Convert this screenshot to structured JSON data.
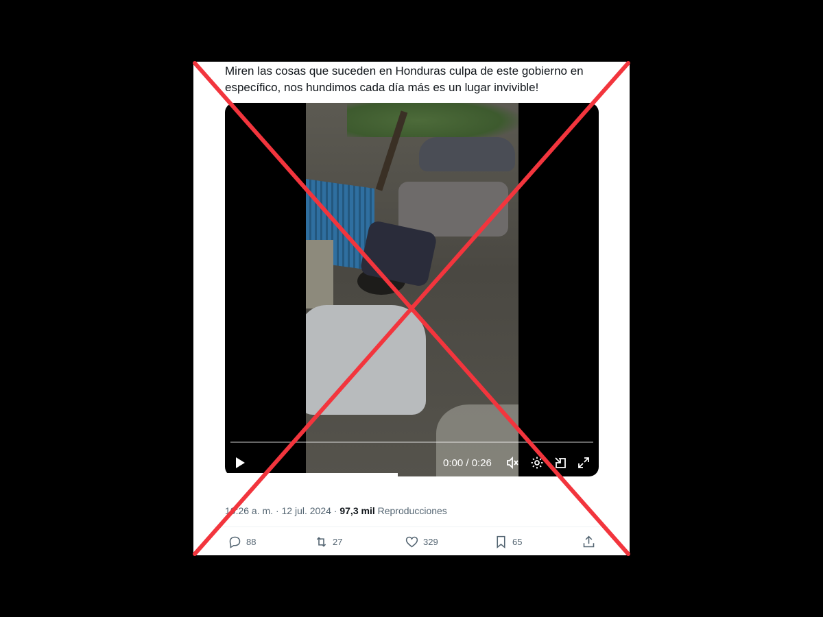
{
  "tweet": {
    "text": "Miren las cosas que suceden en Honduras culpa de este gobierno en específico, nos hundimos cada día más es un lugar invivible!"
  },
  "video": {
    "time_display": "0:00 / 0:26",
    "progress": 0
  },
  "meta": {
    "time": "10:26 a. m.",
    "separator": "·",
    "date": "12 jul. 2024",
    "views_count": "97,3 mil",
    "views_label": "Reproducciones"
  },
  "actions": {
    "replies": "88",
    "reposts": "27",
    "likes": "329",
    "bookmarks": "65"
  },
  "icons": {
    "play": "play-icon",
    "volume": "volume-icon",
    "settings": "gear-icon",
    "dock": "picture-in-picture-icon",
    "fullscreen": "expand-icon",
    "reply": "speech-bubble-icon",
    "repost": "repost-icon",
    "like": "heart-icon",
    "bookmark": "bookmark-icon",
    "share": "share-icon"
  },
  "colors": {
    "cross": "#f2353d",
    "text": "#0f1419",
    "muted": "#536471"
  }
}
